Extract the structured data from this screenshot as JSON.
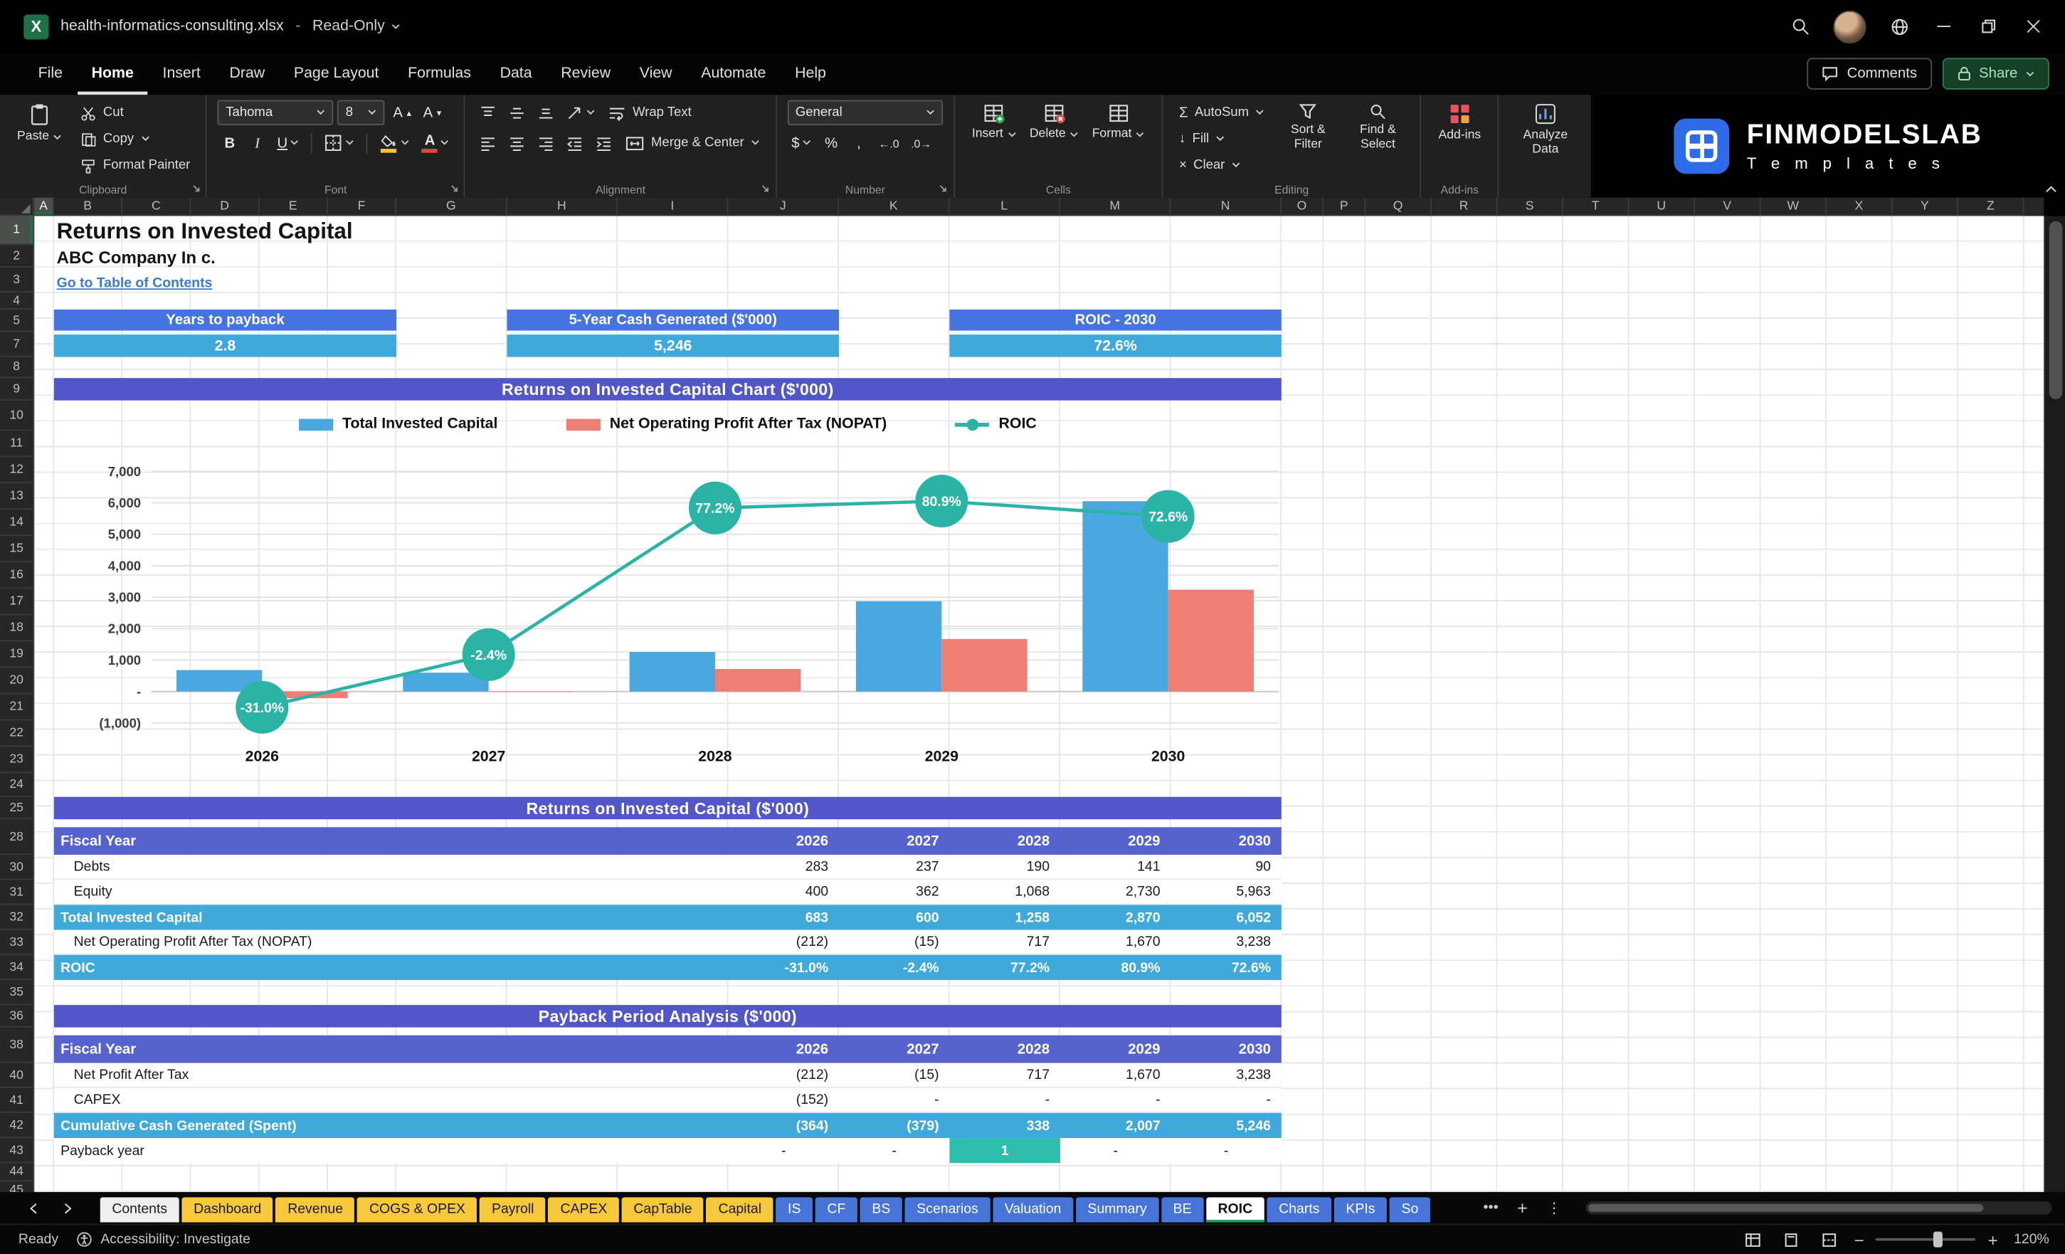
{
  "titlebar": {
    "filename": "health-informatics-consulting.xlsx",
    "separator": "-",
    "mode": "Read-Only"
  },
  "menubar": {
    "items": [
      "File",
      "Home",
      "Insert",
      "Draw",
      "Page Layout",
      "Formulas",
      "Data",
      "Review",
      "View",
      "Automate",
      "Help"
    ],
    "active_index": 1,
    "comments_label": "Comments",
    "share_label": "Share"
  },
  "ribbon": {
    "paste": "Paste",
    "cut": "Cut",
    "copy": "Copy",
    "format_painter": "Format Painter",
    "clipboard_group": "Clipboard",
    "font_name": "Tahoma",
    "font_size": "8",
    "font_group": "Font",
    "wrap_text": "Wrap Text",
    "merge_center": "Merge & Center",
    "alignment_group": "Alignment",
    "number_format": "General",
    "number_group": "Number",
    "insert": "Insert",
    "delete": "Delete",
    "format": "Format",
    "cells_group": "Cells",
    "autosum": "AutoSum",
    "fill": "Fill",
    "clear": "Clear",
    "sort_filter": "Sort & Filter",
    "find_select": "Find & Select",
    "editing_group": "Editing",
    "addins": "Add-ins",
    "addins_group": "Add-ins",
    "analyze_data": "Analyze Data",
    "icons": {
      "bold": "B",
      "italic": "I",
      "underline": "U",
      "grow_font": "A",
      "shrink_font": "A",
      "currency": "$",
      "percent": "%",
      "comma": ",",
      "increase_decimal": "←.0",
      "decrease_decimal": ".0→",
      "autosum_sigma": "Σ",
      "fill_arrow": "↓",
      "clear_x": "×",
      "font_color_letter": "A"
    }
  },
  "logo": {
    "name": "FINMODELSLAB",
    "subtitle": "T e m p l a t e s"
  },
  "grid": {
    "columns": [
      "A",
      "B",
      "C",
      "D",
      "E",
      "F",
      "G",
      "H",
      "I",
      "J",
      "K",
      "L",
      "M",
      "N",
      "O",
      "P",
      "Q",
      "R",
      "S",
      "T",
      "U",
      "V",
      "W",
      "X",
      "Y",
      "Z"
    ],
    "rows": [
      "1",
      "2",
      "3",
      "4",
      "5",
      "7",
      "8",
      "9",
      "10",
      "11",
      "12",
      "13",
      "14",
      "15",
      "16",
      "17",
      "18",
      "19",
      "20",
      "21",
      "22",
      "23",
      "24",
      "25",
      "28",
      "30",
      "31",
      "32",
      "33",
      "34",
      "35",
      "36",
      "38",
      "40",
      "41",
      "42",
      "43",
      "44",
      "45"
    ]
  },
  "sheet": {
    "title": "Returns on Invested Capital",
    "company": "ABC Company In c.",
    "toc_link": "Go to Table of Contents",
    "kpis": [
      {
        "label": "Years to payback",
        "value": "2.8"
      },
      {
        "label": "5-Year Cash Generated ($'000)",
        "value": "5,246"
      },
      {
        "label": "ROIC - 2030",
        "value": "72.6%"
      }
    ],
    "chart_banner": "Returns on Invested Capital Chart ($'000)",
    "table1": {
      "banner": "Returns on Invested Capital ($'000)",
      "header_label": "Fiscal Year",
      "years": [
        "2026",
        "2027",
        "2028",
        "2029",
        "2030"
      ],
      "rows": [
        {
          "label": "Debts",
          "values": [
            "283",
            "237",
            "190",
            "141",
            "90"
          ],
          "style": "plain"
        },
        {
          "label": "Equity",
          "values": [
            "400",
            "362",
            "1,068",
            "2,730",
            "5,963"
          ],
          "style": "plain"
        },
        {
          "label": "Total Invested Capital",
          "values": [
            "683",
            "600",
            "1,258",
            "2,870",
            "6,052"
          ],
          "style": "accent"
        },
        {
          "label": "Net Operating Profit After Tax (NOPAT)",
          "values": [
            "(212)",
            "(15)",
            "717",
            "1,670",
            "3,238"
          ],
          "style": "plain"
        },
        {
          "label": "ROIC",
          "values": [
            "-31.0%",
            "-2.4%",
            "77.2%",
            "80.9%",
            "72.6%"
          ],
          "style": "accent"
        }
      ]
    },
    "table2": {
      "banner": "Payback Period Analysis ($'000)",
      "header_label": "Fiscal Year",
      "years": [
        "2026",
        "2027",
        "2028",
        "2029",
        "2030"
      ],
      "rows": [
        {
          "label": "Net Profit After Tax",
          "values": [
            "(212)",
            "(15)",
            "717",
            "1,670",
            "3,238"
          ],
          "style": "plain"
        },
        {
          "label": "CAPEX",
          "values": [
            "(152)",
            "-",
            "-",
            "-",
            "-"
          ],
          "style": "plain"
        },
        {
          "label": "Cumulative Cash Generated (Spent)",
          "values": [
            "(364)",
            "(379)",
            "338",
            "2,007",
            "5,246"
          ],
          "style": "accent"
        },
        {
          "label": "Payback year",
          "values": [
            "-",
            "-",
            "1",
            "-",
            "-"
          ],
          "style": "payback",
          "highlight_index": 2
        }
      ]
    }
  },
  "chart_data": {
    "type": "combo",
    "title": "Returns on Invested Capital Chart ($'000)",
    "categories": [
      "2026",
      "2027",
      "2028",
      "2029",
      "2030"
    ],
    "series": [
      {
        "name": "Total Invested Capital",
        "type": "bar",
        "color": "#49A8DF",
        "values": [
          683,
          600,
          1258,
          2870,
          6052
        ]
      },
      {
        "name": "Net Operating Profit After Tax (NOPAT)",
        "type": "bar",
        "color": "#EF7F75",
        "values": [
          -212,
          -15,
          717,
          1670,
          3238
        ]
      },
      {
        "name": "ROIC",
        "type": "line",
        "color": "#2BB4A5",
        "values_pct": [
          -31.0,
          -2.4,
          77.2,
          80.9,
          72.6
        ],
        "point_labels": [
          "-31.0%",
          "-2.4%",
          "77.2%",
          "80.9%",
          "72.6%"
        ]
      }
    ],
    "y_axis": {
      "ticks": [
        "7,000",
        "6,000",
        "5,000",
        "4,000",
        "3,000",
        "2,000",
        "1,000",
        "-",
        "(1,000)"
      ],
      "tick_values": [
        7000,
        6000,
        5000,
        4000,
        3000,
        2000,
        1000,
        0,
        -1000
      ],
      "min": -1000,
      "max": 7000
    },
    "legend_position": "top",
    "grid": true
  },
  "tabs": {
    "items": [
      {
        "label": "Contents",
        "type": "light"
      },
      {
        "label": "Dashboard",
        "type": "yellow"
      },
      {
        "label": "Revenue",
        "type": "yellow"
      },
      {
        "label": "COGS & OPEX",
        "type": "yellow"
      },
      {
        "label": "Payroll",
        "type": "yellow"
      },
      {
        "label": "CAPEX",
        "type": "yellow"
      },
      {
        "label": "CapTable",
        "type": "yellow"
      },
      {
        "label": "Capital",
        "type": "yellow"
      },
      {
        "label": "IS",
        "type": "blue"
      },
      {
        "label": "CF",
        "type": "blue"
      },
      {
        "label": "BS",
        "type": "blue"
      },
      {
        "label": "Scenarios",
        "type": "blue"
      },
      {
        "label": "Valuation",
        "type": "blue"
      },
      {
        "label": "Summary",
        "type": "blue"
      },
      {
        "label": "BE",
        "type": "blue"
      },
      {
        "label": "ROIC",
        "type": "active"
      },
      {
        "label": "Charts",
        "type": "blue"
      },
      {
        "label": "KPIs",
        "type": "blue"
      },
      {
        "label": "So",
        "type": "blue"
      }
    ]
  },
  "statusbar": {
    "ready": "Ready",
    "accessibility": "Accessibility: Investigate",
    "zoom": "120%"
  },
  "colors": {
    "banner": "#5157C8",
    "table_header": "#5663CF",
    "kpi_header": "#4573E0",
    "kpi_value": "#3FA9DC",
    "accent_row": "#3FA9DC",
    "payback_cell": "#2CBFAE",
    "bar_blue": "#49A8DF",
    "bar_red": "#EF7F75",
    "line_teal": "#2BB4A5",
    "tab_yellow": "#F7C83C",
    "tab_blue": "#4674D8",
    "link": "#3D7BC8"
  }
}
